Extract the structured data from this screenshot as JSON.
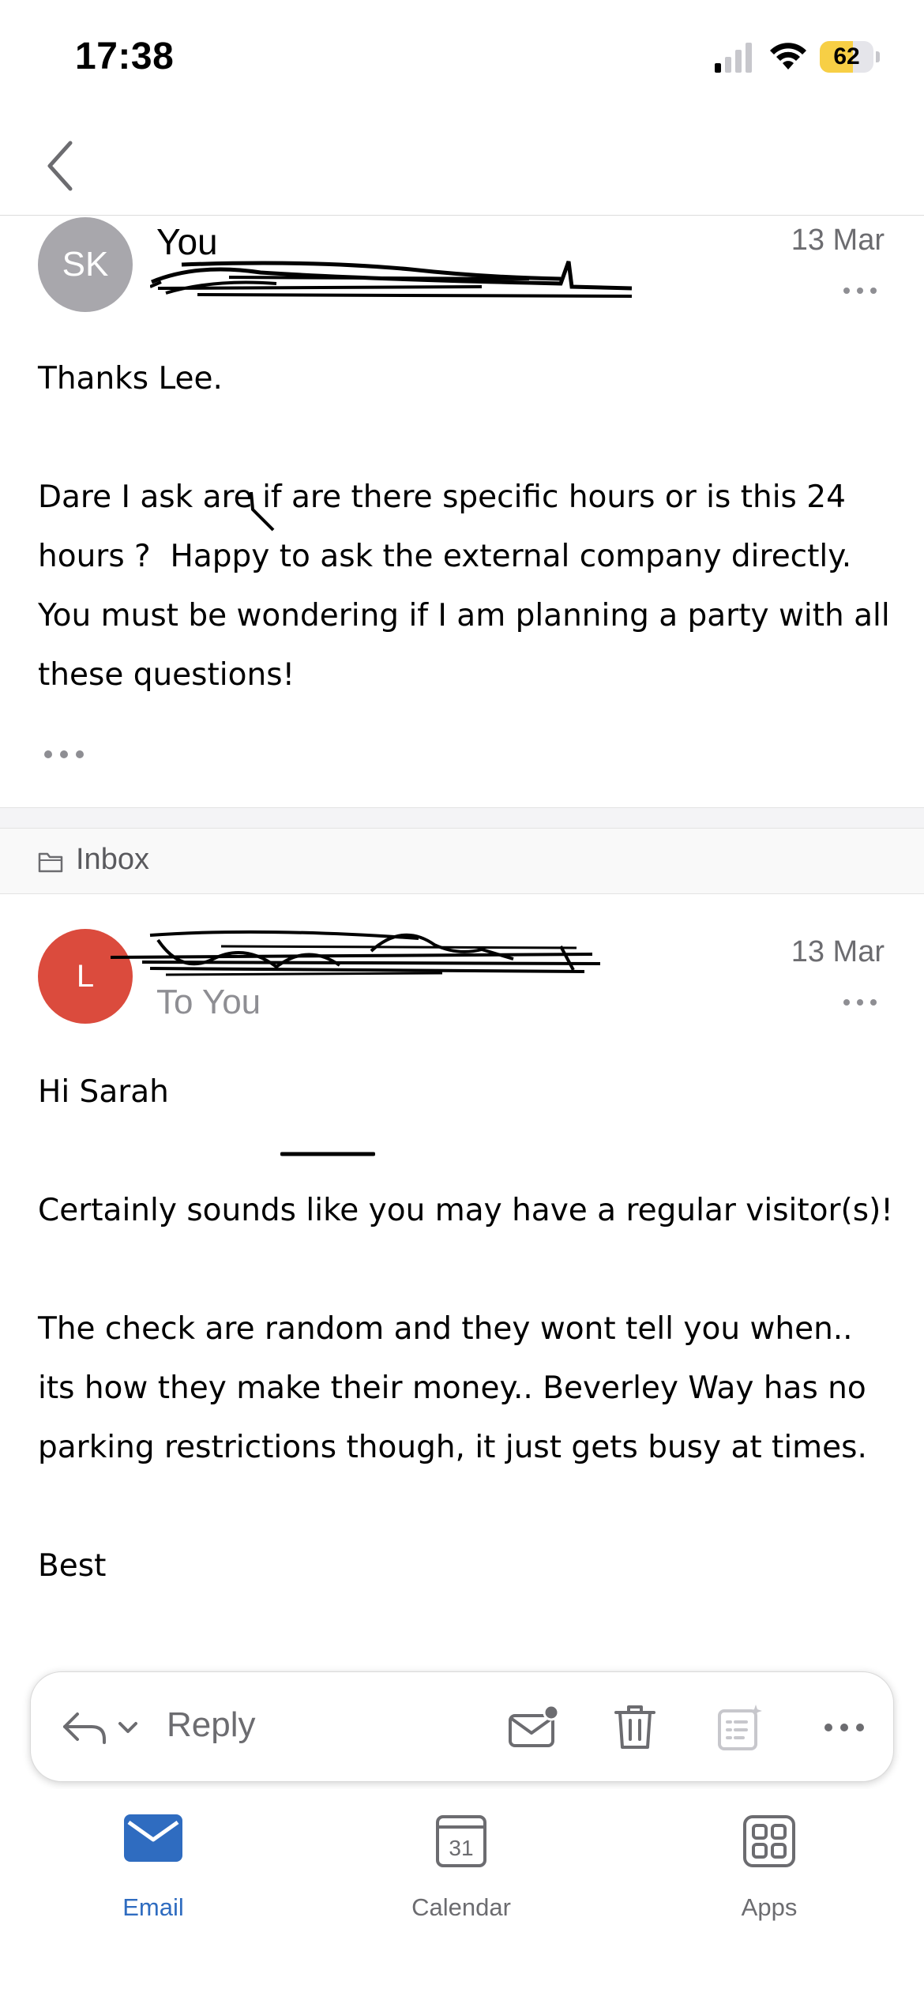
{
  "status_bar": {
    "time": "17:38",
    "battery_percent": "62",
    "battery_level": 0.62,
    "signal_bars_active": 1,
    "icons": [
      "signal-icon",
      "wifi-icon",
      "battery-icon"
    ]
  },
  "nav": {
    "back_icon": "chevron-left-icon"
  },
  "messages": [
    {
      "avatar_initials": "SK",
      "avatar_color": "#a8a7ac",
      "sender": "You",
      "sub": "",
      "date": "13 Mar",
      "paragraphs": [
        "Thanks Lee.",
        "Dare I ask are if are there specific hours or is this 24 hours ?  Happy to ask the external company directly.  You must be wondering if I am planning a party with all these questions!"
      ]
    },
    {
      "avatar_initials": "L",
      "avatar_color": "#db4b3d",
      "sender": "",
      "sub": "To You",
      "date": "13 Mar",
      "paragraphs": [
        "Hi Sarah",
        "Certainly sounds like you may have a regular visitor(s)!",
        "The check are random and they wont tell you when.. its how they make their money.. Beverley Way has no parking restrictions though, it just gets busy at times.",
        "Best"
      ]
    }
  ],
  "folder": {
    "label": "Inbox",
    "icon": "folder-icon"
  },
  "toolbar": {
    "reply_label": "Reply",
    "icons": [
      "reply-icon",
      "chevron-down-icon",
      "mark-unread-icon",
      "trash-icon",
      "summarize-icon",
      "more-icon"
    ]
  },
  "tabs": [
    {
      "label": "Email",
      "icon": "mail-icon",
      "active": true
    },
    {
      "label": "Calendar",
      "icon": "calendar-icon",
      "day": "31",
      "active": false
    },
    {
      "label": "Apps",
      "icon": "apps-grid-icon",
      "active": false
    }
  ],
  "colors": {
    "accent": "#2f6cc0",
    "battery_fill": "#f7cf45",
    "secondary_text": "#6c6c70"
  }
}
